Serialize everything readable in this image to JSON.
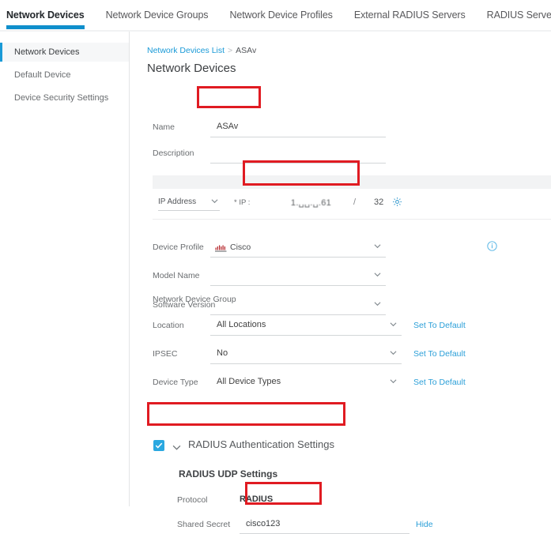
{
  "tabs": [
    {
      "label": "Network Devices",
      "active": true
    },
    {
      "label": "Network Device Groups",
      "active": false
    },
    {
      "label": "Network Device Profiles",
      "active": false
    },
    {
      "label": "External RADIUS Servers",
      "active": false
    },
    {
      "label": "RADIUS Server Sequences",
      "active": false
    }
  ],
  "sidebar": {
    "items": [
      {
        "label": "Network Devices",
        "active": true
      },
      {
        "label": "Default Device",
        "active": false
      },
      {
        "label": "Device Security Settings",
        "active": false
      }
    ]
  },
  "breadcrumb": {
    "parent": "Network Devices List",
    "separator": ">",
    "current": "ASAv"
  },
  "page_title": "Network Devices",
  "form": {
    "name": {
      "label": "Name",
      "value": "ASAv"
    },
    "description": {
      "label": "Description",
      "value": ""
    },
    "ip": {
      "type_label": "IP Address",
      "star_label": "* IP :",
      "address": "1.␣␣.␣.61",
      "slash": "/",
      "mask": "32",
      "gear_icon": "gear-icon"
    },
    "device_profile": {
      "label": "Device Profile",
      "value": "Cisco",
      "icon": "cisco-logo-icon",
      "info_icon": "info-icon"
    },
    "model_name": {
      "label": "Model Name",
      "value": ""
    },
    "software_version": {
      "label": "Software Version",
      "value": ""
    },
    "network_device_group": {
      "title": "Network Device Group",
      "rows": [
        {
          "label": "Location",
          "value": "All Locations",
          "action": "Set To Default"
        },
        {
          "label": "IPSEC",
          "value": "No",
          "action": "Set To Default"
        },
        {
          "label": "Device Type",
          "value": "All Device Types",
          "action": "Set To Default"
        }
      ]
    }
  },
  "radius": {
    "section_title": "RADIUS Authentication Settings",
    "checked": true,
    "udp_title": "RADIUS UDP Settings",
    "protocol_label": "Protocol",
    "protocol_value": "RADIUS",
    "shared_secret_label": "Shared Secret",
    "shared_secret_value": "cisco123",
    "hide_label": "Hide"
  },
  "colors": {
    "accent_blue": "#1a9ad7",
    "tab_underline": "#0f8fcc",
    "highlight_red": "#e01b22",
    "checkbox_blue": "#2aa8e0",
    "link_blue": "#2b9fd8"
  }
}
